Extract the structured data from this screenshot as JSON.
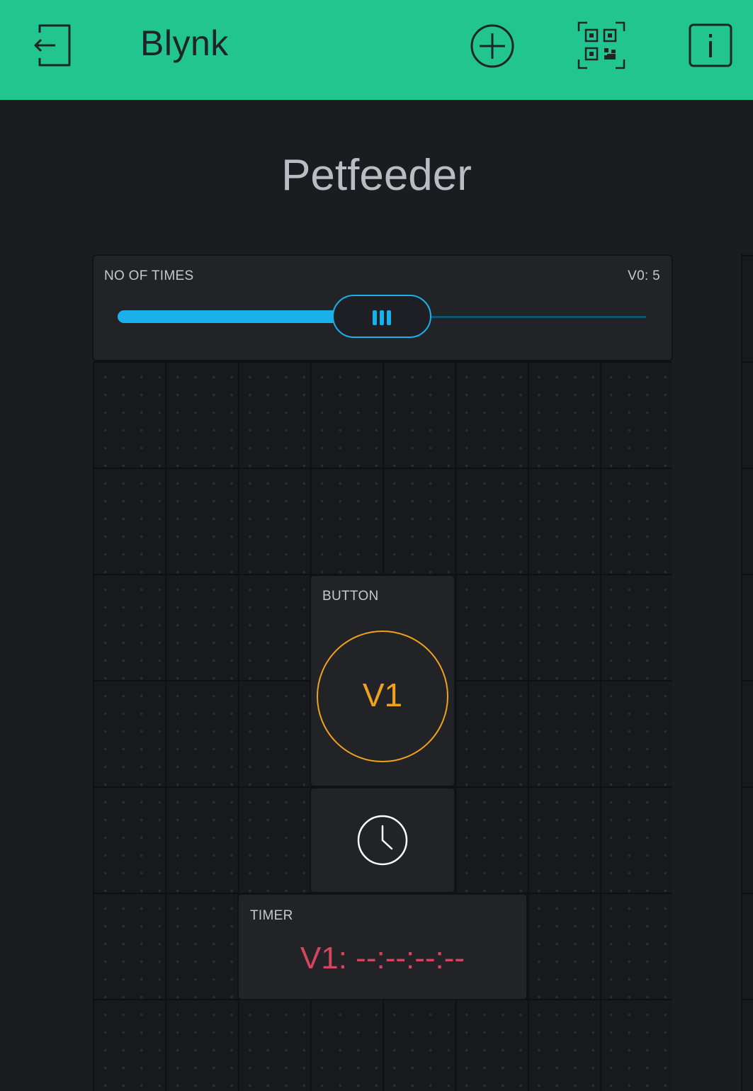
{
  "header": {
    "app_title": "Blynk",
    "icons": [
      "logout-icon",
      "add-circle-icon",
      "qr-code-icon",
      "info-icon"
    ],
    "color": "#23c58f"
  },
  "project": {
    "title": "Petfeeder"
  },
  "slider_widget": {
    "label": "NO OF TIMES",
    "pin_value": "V0: 5",
    "level_fraction": 0.5,
    "color": "#1ab0ea"
  },
  "button_widget": {
    "label": "BUTTON",
    "pin": "V1",
    "color": "#f0a21c"
  },
  "clock_widget": {
    "icon": "clock-icon"
  },
  "timer_widget": {
    "label": "TIMER",
    "value": "V1: --:--:--:--",
    "color": "#d3465c"
  }
}
